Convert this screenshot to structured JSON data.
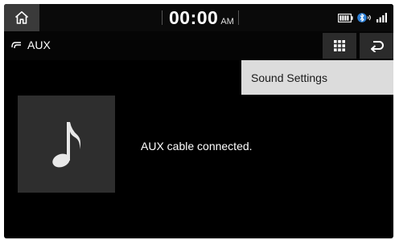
{
  "status_bar": {
    "time": "00:00",
    "ampm": "AM",
    "icons": [
      "home-icon",
      "battery-icon",
      "bluetooth-audio-icon",
      "signal-strength-icon"
    ]
  },
  "title_bar": {
    "source_label": "AUX",
    "icons": [
      "aux-cable-icon",
      "menu-grid-icon",
      "back-arrow-icon"
    ]
  },
  "dropdown_menu": {
    "items": [
      {
        "label": "Sound Settings"
      }
    ]
  },
  "main": {
    "status_message": "AUX cable connected.",
    "album_art_icon": "music-note-icon"
  },
  "colors": {
    "screen_bg": "#000000",
    "button_bg": "#2b2b2b",
    "home_bg": "#3a3a3a",
    "album_bg": "#2e2e2e",
    "menu_bg": "#dcdcdc"
  }
}
